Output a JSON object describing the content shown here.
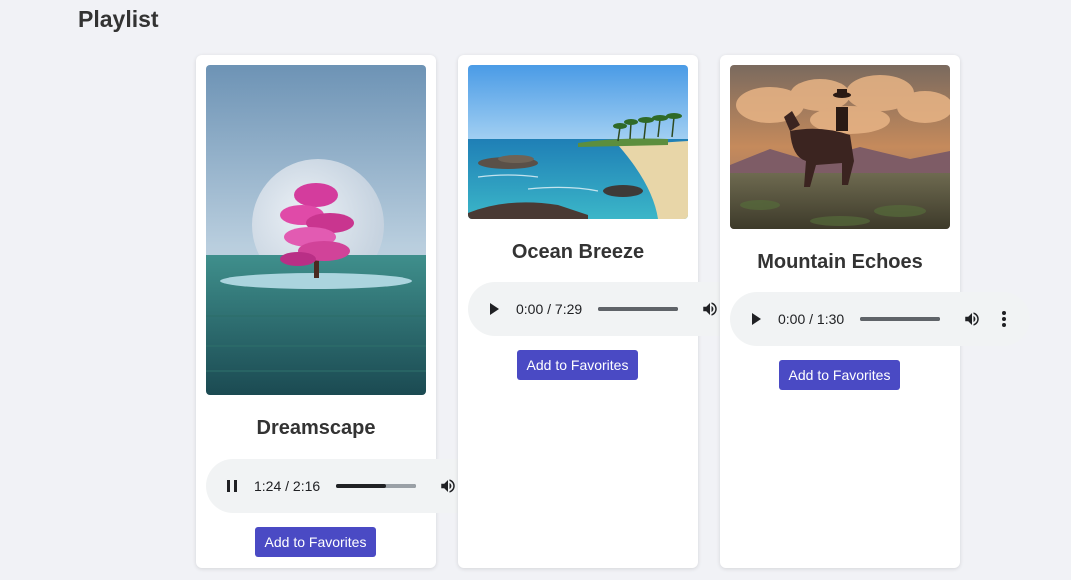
{
  "page": {
    "title": "Playlist"
  },
  "colors": {
    "background": "#f1f2f6",
    "card": "#ffffff",
    "accent_button": "#4a4ac4",
    "player_bg": "#f1f3f4"
  },
  "songs": [
    {
      "title": "Dreamscape",
      "cover": "surreal-pink-tree-moon-image",
      "player": {
        "state": "playing",
        "time": "1:24 / 2:16",
        "progress": 0.618
      },
      "favorite_label": "Add to Favorites"
    },
    {
      "title": "Ocean Breeze",
      "cover": "tropical-beach-image",
      "player": {
        "state": "paused",
        "time": "0:00 / 7:29",
        "progress": 0
      },
      "favorite_label": "Add to Favorites"
    },
    {
      "title": "Mountain Echoes",
      "cover": "cowboy-on-horse-painting-image",
      "player": {
        "state": "paused",
        "time": "0:00 / 1:30",
        "progress": 0
      },
      "favorite_label": "Add to Favorites"
    }
  ],
  "icons": {
    "play": "play-icon",
    "pause": "pause-icon",
    "volume": "volume-icon",
    "more": "more-vert-icon"
  }
}
